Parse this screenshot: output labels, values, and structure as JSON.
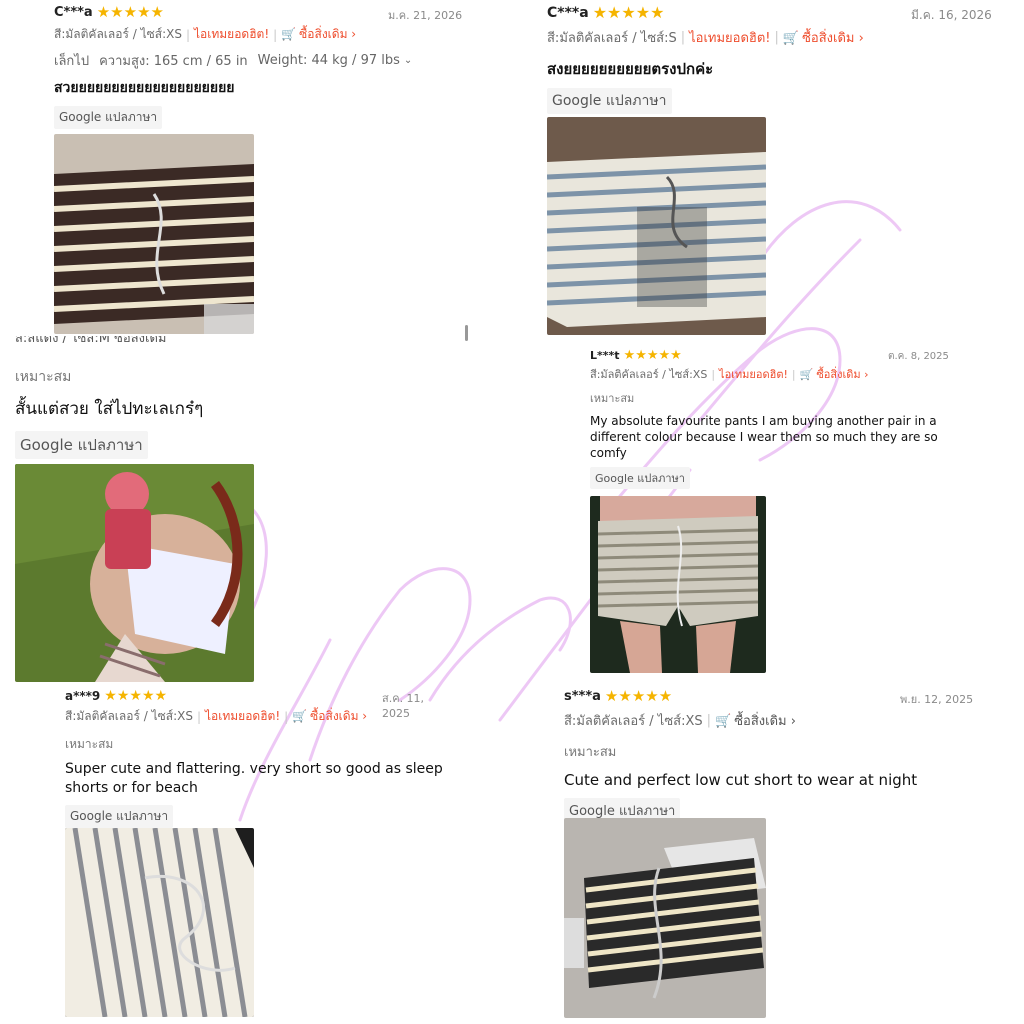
{
  "reviews": [
    {
      "user": "C***a",
      "date": "ม.ค. 21, 2026",
      "variant": "สี:มัลติคัลเลอร์ / ไซส์:XS",
      "hot_label": "ไอเทมยอดฮิต!",
      "buy_again": "ซื้อสิ่งเดิม",
      "fit_label": "เล็กไป",
      "height_label": "ความสูง: 165 cm / 65 in",
      "weight_label": "Weight: 44 kg / 97 lbs",
      "text": "สวยยยยยยยยยยยยยยยยยยยย",
      "translate": "Google แปลภาษา",
      "stars": 5
    },
    {
      "user": "C***a",
      "date": "มี.ค. 16, 2026",
      "variant": "สี:มัลติคัลเลอร์ / ไซส์:S",
      "hot_label": "ไอเทมยอดฮิต!",
      "buy_again": "ซื้อสิ่งเดิม",
      "text": "สงยยยยยยยยยยตรงปกค่ะ",
      "translate": "Google แปลภาษา",
      "stars": 5
    },
    {
      "partial_meta": "สี:สีแดง / ไซส์:M  ซื้อสิ่งเดิม",
      "suitability": "เหมาะสม",
      "text": "สั้นแต่สวย ใส่ไปทะเลเกร๋ๆ",
      "translate": "Google แปลภาษา"
    },
    {
      "user": "L***t",
      "date": "ต.ค. 8, 2025",
      "variant": "สี:มัลติคัลเลอร์ / ไซส์:XS",
      "hot_label": "ไอเทมยอดฮิต!",
      "buy_again": "ซื้อสิ่งเดิม",
      "suitability": "เหมาะสม",
      "text": "My absolute favourite pants I am buying another pair in a different colour because I wear them so much they are so comfy",
      "translate": "Google แปลภาษา",
      "stars": 5
    },
    {
      "user": "a***9",
      "date": "ส.ค. 11, 2025",
      "variant": "สี:มัลติคัลเลอร์ / ไซส์:XS",
      "hot_label": "ไอเทมยอดฮิต!",
      "buy_again": "ซื้อสิ่งเดิม",
      "suitability": "เหมาะสม",
      "text": "Super cute and flattering. very short so good as sleep shorts or for beach",
      "translate": "Google แปลภาษา",
      "stars": 5
    },
    {
      "user": "s***a",
      "date": "พ.ย. 12, 2025",
      "variant": "สี:มัลติคัลเลอร์ / ไซส์:XS",
      "buy_again": "ซื้อสิ่งเดิม",
      "suitability": "เหมาะสม",
      "text": "Cute and perfect low cut short to wear at night",
      "translate": "Google แปลภาษา",
      "stars": 5
    }
  ],
  "colors": {
    "star": "#f5b400",
    "accent": "#ee4d2d",
    "watermark": "#e8b6f2"
  }
}
